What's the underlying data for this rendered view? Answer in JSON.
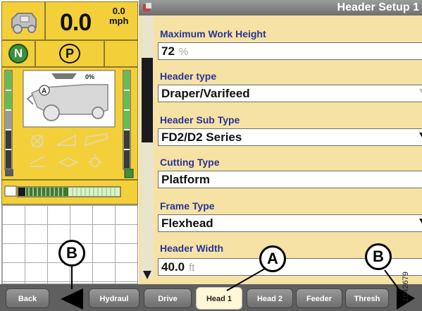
{
  "status": {
    "speed_value": "0.0",
    "speed_small_value": "0.0",
    "speed_unit": "mph",
    "gear_n": "N",
    "gear_p": "P",
    "header_fill_percent": "0%",
    "machine_label": "A"
  },
  "setup": {
    "title": "Header Setup 1",
    "fields": [
      {
        "label": "Maximum Work Height",
        "value": "72",
        "unit": "%"
      },
      {
        "label": "Header type",
        "value": "Draper/Varifeed"
      },
      {
        "label": "Header Sub Type",
        "value": "FD2/D2 Series"
      },
      {
        "label": "Cutting Type",
        "value": "Platform"
      },
      {
        "label": "Frame Type",
        "value": "Flexhead"
      },
      {
        "label": "Header Width",
        "value": "40.0",
        "unit": "ft"
      }
    ]
  },
  "tabs": {
    "back": "Back",
    "hydraul": "Hydraul",
    "drive": "Drive",
    "head1": "Head 1",
    "head2": "Head 2",
    "feeder": "Feeder",
    "thresh": "Thresh"
  },
  "callouts": {
    "b_left": "B",
    "a": "A",
    "b_right": "B"
  },
  "figure_number": "1042679",
  "colors": {
    "status_yellow": "#f3cf3a",
    "panel_cream": "#f6e2a4",
    "label_blue": "#27349a",
    "gear_green": "#3d8f3d"
  },
  "icons": {
    "speed": "combine-speed-icon",
    "back_nav": "left-arrow-icon",
    "next_nav": "right-arrow-icon"
  }
}
